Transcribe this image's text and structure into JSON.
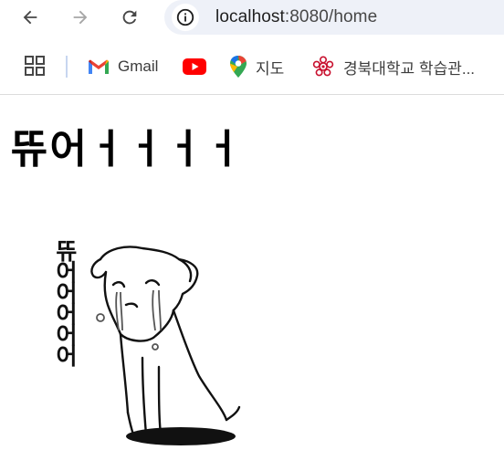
{
  "browser": {
    "url_host": "localhost",
    "url_rest": ":8080/home",
    "bookmarks": [
      {
        "label": "Gmail",
        "icon": "gmail-icon"
      },
      {
        "label": "",
        "icon": "youtube-icon"
      },
      {
        "label": "지도",
        "icon": "maps-pin-icon"
      },
      {
        "label": "경북대학교 학습관...",
        "icon": "knu-emblem-icon"
      }
    ]
  },
  "page": {
    "heading": "뜌어ㅓㅓㅓㅓ",
    "image_text": "뜌어어어어어"
  },
  "colors": {
    "omnibox_bg": "#eef1f8",
    "heading": "#000000",
    "youtube_red": "#ff0000",
    "knu_red": "#c8102e"
  }
}
